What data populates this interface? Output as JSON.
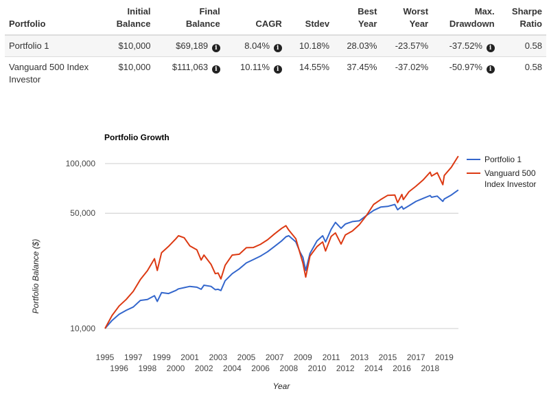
{
  "table": {
    "headers": [
      {
        "line1": "",
        "line2": "Portfolio"
      },
      {
        "line1": "Initial",
        "line2": "Balance"
      },
      {
        "line1": "Final",
        "line2": "Balance"
      },
      {
        "line1": "",
        "line2": "CAGR"
      },
      {
        "line1": "",
        "line2": "Stdev"
      },
      {
        "line1": "Best",
        "line2": "Year"
      },
      {
        "line1": "Worst",
        "line2": "Year"
      },
      {
        "line1": "Max.",
        "line2": "Drawdown"
      },
      {
        "line1": "Sharpe",
        "line2": "Ratio"
      }
    ],
    "rows": [
      {
        "portfolio": "Portfolio 1",
        "initial_balance": "$10,000",
        "final_balance": "$69,189",
        "cagr": "8.04%",
        "stdev": "10.18%",
        "best_year": "28.03%",
        "worst_year": "-23.57%",
        "max_drawdown": "-37.52%",
        "sharpe_ratio": "0.58"
      },
      {
        "portfolio": "Vanguard 500 Index Investor",
        "initial_balance": "$10,000",
        "final_balance": "$111,063",
        "cagr": "10.11%",
        "stdev": "14.55%",
        "best_year": "37.45%",
        "worst_year": "-37.02%",
        "max_drawdown": "-50.97%",
        "sharpe_ratio": "0.58"
      }
    ],
    "info_icon_glyph": "i"
  },
  "chart_data": {
    "type": "line",
    "title": "Portfolio Growth",
    "xlabel": "Year",
    "ylabel": "Portfolio Balance ($)",
    "yscale": "log",
    "ylim": [
      9000,
      115000
    ],
    "yticks": [
      10000,
      50000,
      100000
    ],
    "ytick_labels": [
      "10,000",
      "50,000",
      "100,000"
    ],
    "xlim": [
      1995,
      2020
    ],
    "xticks_top": [
      "1995",
      "1997",
      "1999",
      "2001",
      "2003",
      "2005",
      "2007",
      "2009",
      "2011",
      "2013",
      "2015",
      "2017",
      "2019"
    ],
    "xticks_bottom": [
      "1996",
      "1998",
      "2000",
      "2002",
      "2004",
      "2006",
      "2008",
      "2010",
      "2012",
      "2014",
      "2016",
      "2018"
    ],
    "grid": true,
    "legend_position": "right",
    "x": [
      1995,
      1995.5,
      1996,
      1996.5,
      1997,
      1997.5,
      1998,
      1998.5,
      1998.7,
      1999,
      1999.5,
      2000,
      2000.2,
      2000.6,
      2001,
      2001.5,
      2001.8,
      2002,
      2002.5,
      2002.8,
      2003,
      2003.2,
      2003.5,
      2004,
      2004.5,
      2005,
      2005.5,
      2006,
      2006.5,
      2007,
      2007.5,
      2007.8,
      2008,
      2008.5,
      2008.8,
      2009,
      2009.2,
      2009.5,
      2010,
      2010.4,
      2010.6,
      2011,
      2011.3,
      2011.7,
      2012,
      2012.5,
      2013,
      2013.5,
      2014,
      2014.5,
      2015,
      2015.5,
      2015.7,
      2016,
      2016.1,
      2016.5,
      2017,
      2017.5,
      2018,
      2018.1,
      2018.5,
      2018.9,
      2019,
      2019.5,
      2019.99
    ],
    "series": [
      {
        "name": "Portfolio 1",
        "color": "#3366cc",
        "values": [
          10000,
          11200,
          12200,
          12900,
          13500,
          14800,
          15000,
          15800,
          14600,
          16500,
          16300,
          17000,
          17400,
          17700,
          18000,
          17800,
          17300,
          18300,
          18000,
          17200,
          17300,
          17000,
          19500,
          21500,
          23000,
          25000,
          26200,
          27500,
          29200,
          31500,
          34000,
          36000,
          36500,
          33500,
          29000,
          27000,
          22500,
          28500,
          34000,
          36500,
          33500,
          40000,
          44000,
          40500,
          43000,
          44500,
          45000,
          48500,
          52000,
          54500,
          55000,
          56500,
          52500,
          55000,
          53000,
          55500,
          59000,
          61500,
          64000,
          62500,
          63500,
          59000,
          61000,
          64500,
          69189
        ]
      },
      {
        "name": "Vanguard 500 Index Investor",
        "color": "#dc3912",
        "values": [
          10000,
          12000,
          13700,
          15000,
          16800,
          19800,
          22400,
          26500,
          22500,
          28800,
          31500,
          34900,
          36500,
          35500,
          31700,
          30000,
          26000,
          27900,
          24500,
          21500,
          21700,
          20000,
          24200,
          27900,
          28200,
          30900,
          31000,
          32400,
          34500,
          37500,
          40500,
          42000,
          39500,
          35000,
          28500,
          24900,
          20500,
          27500,
          31400,
          33500,
          29500,
          36200,
          38000,
          32500,
          36900,
          39000,
          42700,
          48500,
          56500,
          60500,
          64200,
          64500,
          58000,
          65000,
          60500,
          67500,
          72900,
          79500,
          88700,
          84000,
          88000,
          74500,
          84700,
          95000,
          111063
        ]
      }
    ]
  }
}
